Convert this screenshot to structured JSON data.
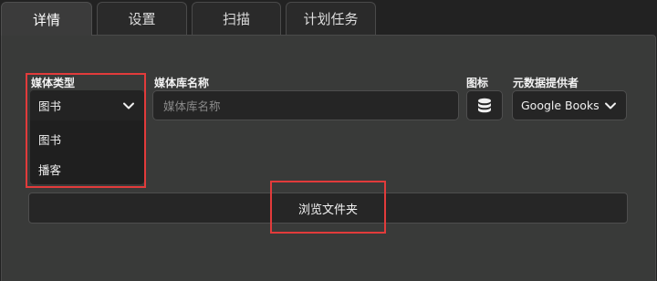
{
  "tabs": [
    {
      "label": "详情"
    },
    {
      "label": "设置"
    },
    {
      "label": "扫描"
    },
    {
      "label": "计划任务"
    }
  ],
  "form": {
    "media_type": {
      "label": "媒体类型",
      "value": "图书",
      "options": [
        "图书",
        "播客"
      ]
    },
    "library_name": {
      "label": "媒体库名称",
      "placeholder": "媒体库名称",
      "value": ""
    },
    "icon": {
      "label": "图标",
      "icon_name": "database-icon"
    },
    "metadata_provider": {
      "label": "元数据提供者",
      "value": "Google Books"
    },
    "browse_button": {
      "label": "浏览文件夹"
    }
  },
  "colors": {
    "highlight": "#e23b3b",
    "panel": "#393a39",
    "field": "#252525"
  }
}
